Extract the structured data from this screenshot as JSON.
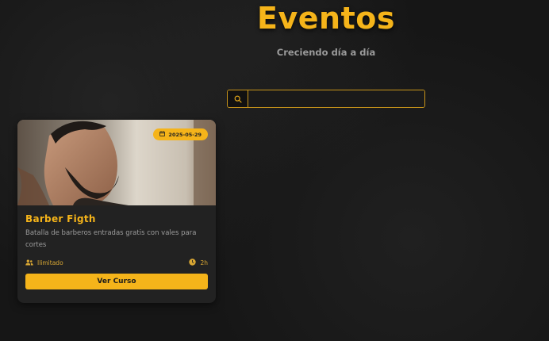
{
  "header": {
    "title": "Eventos",
    "subtitle": "Creciendo día a día"
  },
  "search": {
    "value": "",
    "icon": "search-icon"
  },
  "events": [
    {
      "date": "2025-05-29",
      "title": "Barber Figth",
      "description": "Batalla de barberos entradas gratis con vales para cortes",
      "capacity": "Ilimitado",
      "duration": "2h",
      "cta": "Ver Curso"
    }
  ],
  "colors": {
    "accent": "#f5b41a",
    "background": "#161616",
    "card": "#222222"
  }
}
